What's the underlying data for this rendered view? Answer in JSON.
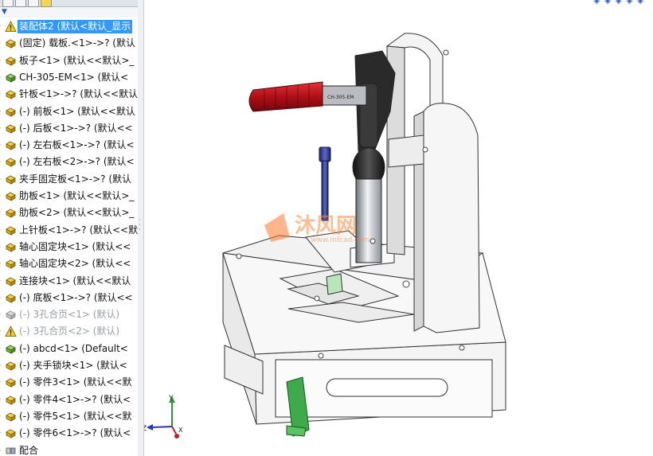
{
  "feature_tree": {
    "items": [
      {
        "label": "装配体2 (默认<默认_显示",
        "icon": "assembly-warning-icon",
        "selected": true,
        "dim": false
      },
      {
        "label": "(固定) 载板.<1>->? (默认",
        "icon": "part-icon",
        "selected": false,
        "dim": false
      },
      {
        "label": "板子<1> (默认<<默认>_",
        "icon": "part-icon",
        "selected": false,
        "dim": false
      },
      {
        "label": "CH-305-EM<1> (默认<",
        "icon": "subassembly-icon",
        "selected": false,
        "dim": false
      },
      {
        "label": "针板<1>->? (默认<<默认",
        "icon": "part-icon",
        "selected": false,
        "dim": false
      },
      {
        "label": "(-) 前板<1> (默认<<默认",
        "icon": "part-icon",
        "selected": false,
        "dim": false
      },
      {
        "label": "(-) 后板<1>->? (默认<<",
        "icon": "part-icon",
        "selected": false,
        "dim": false
      },
      {
        "label": "(-) 左右板<1>->? (默认<",
        "icon": "part-icon",
        "selected": false,
        "dim": false
      },
      {
        "label": "(-) 左右板<2>->? (默认<",
        "icon": "part-icon",
        "selected": false,
        "dim": false
      },
      {
        "label": "夹手固定板<1>->? (默认",
        "icon": "part-icon",
        "selected": false,
        "dim": false
      },
      {
        "label": "肋板<1> (默认<<默认>_",
        "icon": "part-icon",
        "selected": false,
        "dim": false
      },
      {
        "label": "肋板<2> (默认<<默认>_",
        "icon": "part-icon",
        "selected": false,
        "dim": false
      },
      {
        "label": "上针板<1>->? (默认<<默",
        "icon": "part-icon",
        "selected": false,
        "dim": false
      },
      {
        "label": "轴心固定块<1> (默认<<",
        "icon": "part-icon",
        "selected": false,
        "dim": false
      },
      {
        "label": "轴心固定块<2> (默认<<",
        "icon": "part-icon",
        "selected": false,
        "dim": false
      },
      {
        "label": "连接块<1> (默认<<默认",
        "icon": "part-icon",
        "selected": false,
        "dim": false
      },
      {
        "label": "(-) 底板<1>->? (默认<<",
        "icon": "part-icon",
        "selected": false,
        "dim": false
      },
      {
        "label": "(-) 3孔合页<1> (默认)",
        "icon": "suppressed-part-icon",
        "selected": false,
        "dim": true
      },
      {
        "label": "(-) 3孔合页<2> (默认)",
        "icon": "suppressed-warning-icon",
        "selected": false,
        "dim": true
      },
      {
        "label": "(-) abcd<1> (Default<",
        "icon": "subassembly-icon",
        "selected": false,
        "dim": false
      },
      {
        "label": "(-) 夹手锁块<1> (默认<",
        "icon": "part-icon",
        "selected": false,
        "dim": false
      },
      {
        "label": "(-) 零件3<1> (默认<<默",
        "icon": "part-icon",
        "selected": false,
        "dim": false
      },
      {
        "label": "(-) 零件4<1>->? (默认<",
        "icon": "part-icon",
        "selected": false,
        "dim": false
      },
      {
        "label": "(-) 零件5<1> (默认<<默",
        "icon": "part-icon",
        "selected": false,
        "dim": false
      },
      {
        "label": "(-) 零件6<1>->? (默认<",
        "icon": "part-icon",
        "selected": false,
        "dim": false
      },
      {
        "label": "配合",
        "icon": "mates-icon",
        "selected": false,
        "dim": false
      }
    ]
  },
  "viewport": {
    "handle_text": "CH-305-EM",
    "watermark_text": "沐风网",
    "watermark_url": "www.mfcad.com",
    "axis_labels": {
      "x": "X",
      "y": "Y",
      "z": "Z"
    }
  },
  "colors": {
    "selection": "#3399ff",
    "handle": "#c0141c",
    "pin": "#2f3a8a",
    "latch": "#2e9b3a",
    "watermark": "#ff6a1a"
  }
}
